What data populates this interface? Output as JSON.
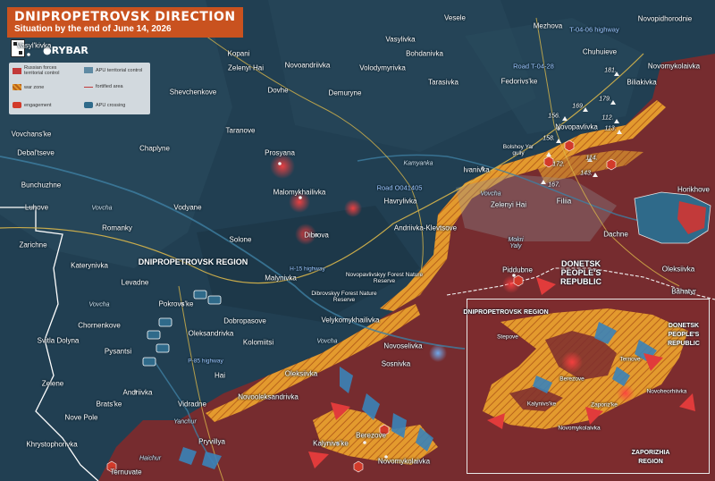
{
  "title": "DNIPROPETROVSK DIRECTION",
  "subtitle": "Situation by the end of June 14, 2026",
  "brand": "RYBAR",
  "legend": {
    "russian_control": "Russian forces territorial control",
    "apu_control": "APU territorial control",
    "war_zone": "war zone",
    "fortified_area": "fortified area",
    "engagement": "engagement",
    "apu_crossing": "APU crossing"
  },
  "colors": {
    "russian_red": "#8e2a2a",
    "war_zone_orange": "#e39a2e",
    "apu_blue": "#2a5a73",
    "title_orange": "#c9521f",
    "background": "#1d3a4c"
  },
  "regions": {
    "dnipropetrovsk": "DNIPROPETROVSK REGION",
    "donetsk": "DONETSK PEOPLE'S REPUBLIC",
    "inset_dnipro": "DNIPROPETROVSK REGION",
    "inset_donetsk": "DONETSK PEOPLE'S REPUBLIC",
    "inset_zaporizhia": "ZAPORIZHIA REGION"
  },
  "roads": {
    "t0406": "T-04-06 highway",
    "t0428": "Road T-04-28",
    "o041405": "Road O041405",
    "h15": "H-15 highway",
    "p85": "P-85 highway"
  },
  "rivers": {
    "vovcha1": "Vovcha",
    "vovcha2": "Vovcha",
    "vovcha3": "Vovcha",
    "kamyanka": "Kamyanka",
    "bolshoy_yar": "Bolshoy Yar gully",
    "mokri_yaly": "Mokri Yaly",
    "yanchur": "Yanchur",
    "haichur": "Haichur",
    "vovcha_inset": "Vovcha"
  },
  "forests": {
    "novopavlivskyy": "Novopavlivskyy Forest Nature Reserve",
    "dibrovskyy": "Dibrovskyy Forest Nature Reserve"
  },
  "settlements": {
    "vasylkivka": "Vasyl'kivka",
    "kopani": "Kopani",
    "zelenyi_hai1": "Zelenyi Hai",
    "novoandriivka": "Novoandriivka",
    "volodymyrivka": "Volodymyrivka",
    "bohdanivka": "Bohdanivka",
    "vesele": "Vesele",
    "mezhova": "Mezhova",
    "novopidhorodnie": "Novopidhorodnie",
    "vasylivka": "Vasylivka",
    "chuhuieve": "Chuhuieve",
    "novomykolaivka1": "Novomykolaivka",
    "shevchenkove": "Shevchenkove",
    "dovhe": "Dovhe",
    "demuryne": "Demuryne",
    "tarasivka": "Tarasivka",
    "fedorivka": "Fedorivs'ke",
    "biliakivka": "Biliakivka",
    "vovchanske": "Vovchans'ke",
    "taranove": "Taranove",
    "chaplyne": "Chaplyne",
    "prosyana": "Prosyana",
    "novopavlivka": "Novopavlivka",
    "debaltseve": "Debal'tseve",
    "bunchuzhne": "Bunchuzhne",
    "malomykhailivka": "Malomykhailivka",
    "ivanivka": "Ivanivka",
    "horikhove": "Horikhove",
    "luhove": "Luhove",
    "vodyane": "Vodyane",
    "havrylivka": "Havrylivka",
    "zelenyi_hai2": "Zelenyi Hai",
    "filiia": "Filiia",
    "romanky": "Romanky",
    "andriivka_klevtsove": "Andriivka-Klevtsove",
    "zarichne": "Zarichne",
    "solone": "Solone",
    "dibrova": "Dibrova",
    "dachne": "Dachne",
    "katerynivka": "Katerynivka",
    "malynivka": "Malynivka",
    "oleksiivka1": "Oleksiivka",
    "levadne": "Levadne",
    "piddubne": "Piddubne",
    "bahatyr": "Bahatyr",
    "pokrovske": "Pokrovs'ke",
    "chornenkove": "Chornenkove",
    "dobropasove": "Dobropasove",
    "velykomykhailivka": "Velykomykhailivka",
    "oleksandrivka": "Oleksandrivka",
    "svitla_dolyna": "Svitla Dolyna",
    "kolomiitsi": "Kolomiitsi",
    "novoselivka": "Novoselivka",
    "pysantsi": "Pysantsi",
    "sosnivka": "Sosnivka",
    "zelene": "Zelene",
    "hai": "Hai",
    "oleksiivka2": "Oleksiivka",
    "novooleksandrivka": "Novooleksandrivka",
    "andriivka": "Andriivka",
    "brats_ke": "Brats'ke",
    "vidradne": "Vidradne",
    "nove_pole": "Nove Pole",
    "pryvillya": "Pryvillya",
    "berezove": "Berezove",
    "kalynivske": "Kalynivs'ke",
    "khrystophorivka": "Khrystophorivka",
    "novomykolaivka2": "Novomykolaivka",
    "ternuvate": "Ternuvate",
    "inset_stepove": "Stepove",
    "inset_ternove": "Ternove",
    "inset_berezove": "Berezove",
    "inset_novoheorhiivka": "Novoheorhiivka",
    "inset_kalynivske": "Kalynivs'ke",
    "inset_zaporizhe": "Zaporiz'ke",
    "inset_novomykolaivka": "Novomykolaivka"
  },
  "heights": [
    "181.",
    "179.",
    "156.",
    "169.",
    "112.",
    "113.",
    "158.",
    "172.",
    "114.",
    "167.",
    "143."
  ]
}
